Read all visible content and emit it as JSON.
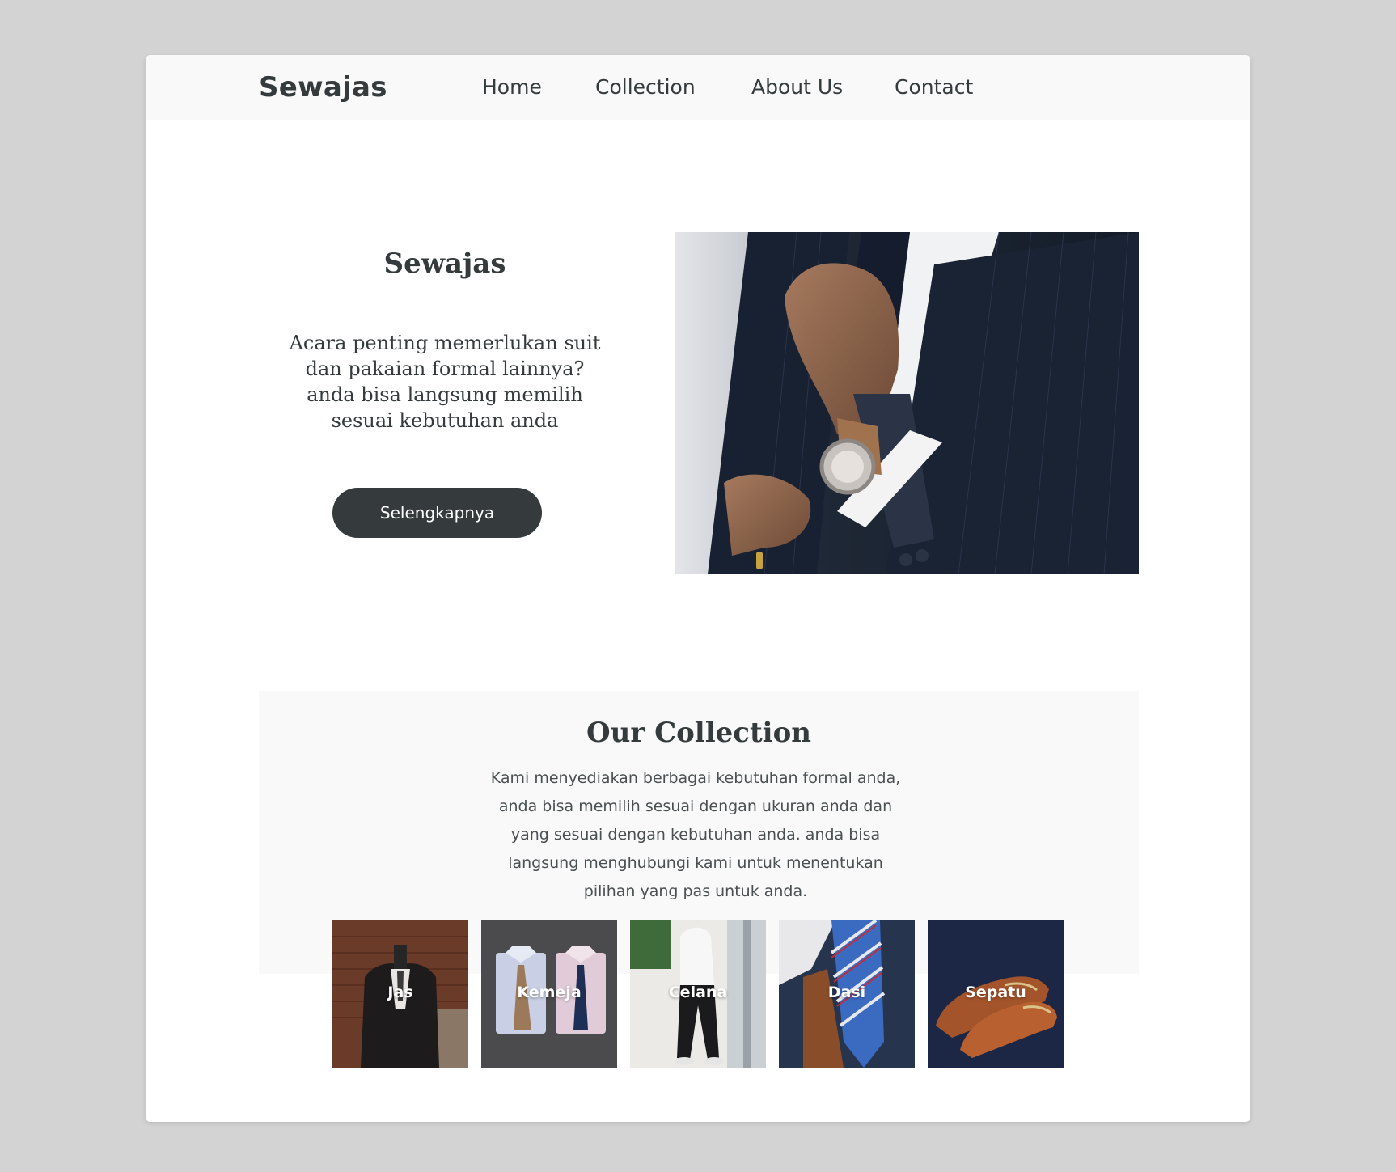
{
  "navbar": {
    "brand": "Sewajas",
    "links": [
      "Home",
      "Collection",
      "About Us",
      "Contact"
    ]
  },
  "hero": {
    "title": "Sewajas",
    "description_lines": [
      "Acara penting memerlukan suit",
      "dan pakaian formal lainnya?",
      "anda bisa langsung memilih",
      "sesuai kebutuhan anda"
    ],
    "button_label": "Selengkapnya",
    "image": "man-in-suit-adjusting-tie-photo"
  },
  "collection": {
    "title": "Our Collection",
    "description_lines": [
      "Kami menyediakan berbagai kebutuhan formal anda,",
      "anda bisa memilih sesuai dengan ukuran anda dan",
      "yang sesuai dengan kebutuhan anda. anda bisa",
      "langsung menghubungi kami untuk menentukan",
      "pilihan yang pas untuk anda."
    ],
    "items": [
      {
        "label": "Jas",
        "image": "suit-jacket-photo"
      },
      {
        "label": "Kemeja",
        "image": "dress-shirts-photo"
      },
      {
        "label": "Celana",
        "image": "trousers-photo"
      },
      {
        "label": "Dasi",
        "image": "necktie-photo"
      },
      {
        "label": "Sepatu",
        "image": "leather-shoes-photo"
      }
    ]
  },
  "colors": {
    "background": "#d3d3d3",
    "surface": "#ffffff",
    "panel": "#f9f9f9",
    "text": "#353b3d",
    "button": "#353b3d",
    "button_text": "#ffffff"
  }
}
